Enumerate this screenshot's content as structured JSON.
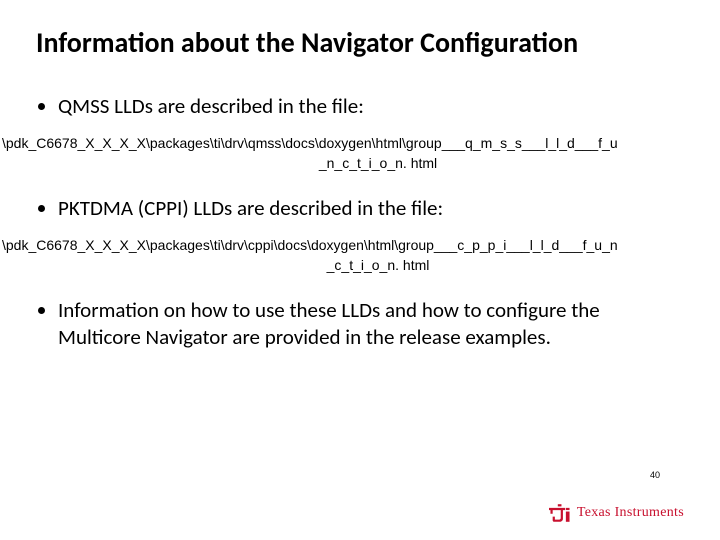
{
  "title": "Information about the Navigator Configuration",
  "bullets": {
    "b1": "QMSS LLDs are described in the file:",
    "b2": "PKTDMA (CPPI)  LLDs are described in the file:",
    "b3": "Information on how to use these LLDs and how to configure the Multicore Navigator are provided in the release examples."
  },
  "paths": {
    "p1_line1": "\\pdk_C6678_X_X_X_X\\packages\\ti\\drv\\qmss\\docs\\doxygen\\html\\group___q_m_s_s___l_l_d___f_u",
    "p1_line2": "_n_c_t_i_o_n. html",
    "p2_line1": "\\pdk_C6678_X_X_X_X\\packages\\ti\\drv\\cppi\\docs\\doxygen\\html\\group___c_p_p_i___l_l_d___f_u_n",
    "p2_line2": "_c_t_i_o_n. html"
  },
  "page_number": "40",
  "logo": {
    "text": "Texas Instruments",
    "icon_name": "ti-logo-icon",
    "brand_color": "#c8102e"
  }
}
